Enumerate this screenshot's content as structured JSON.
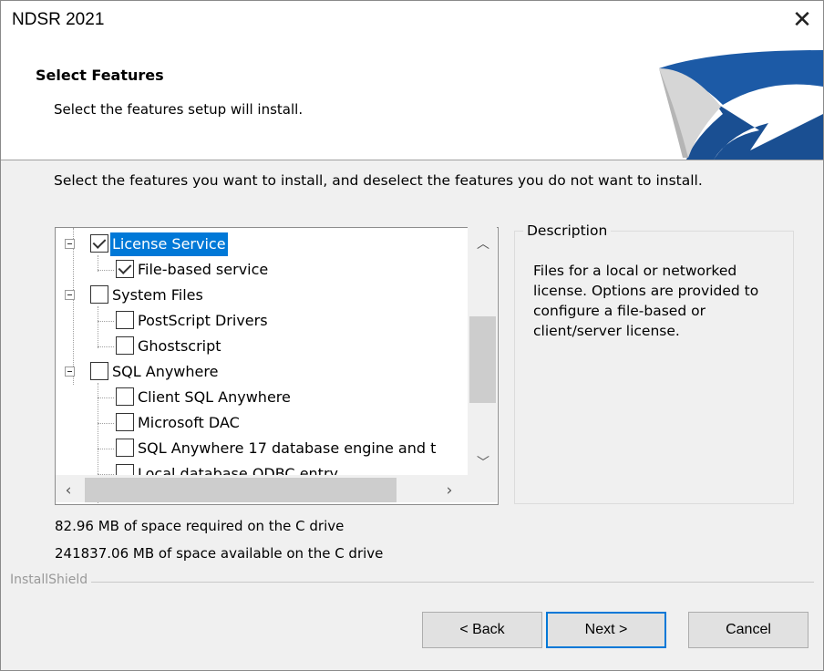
{
  "window": {
    "title": "NDSR 2021",
    "close_glyph": "✕"
  },
  "header": {
    "title": "Select Features",
    "subtitle": "Select the features setup will install."
  },
  "instructions": "Select the features you want to install, and deselect the features you do not want to install.",
  "tree": {
    "items": [
      {
        "label": "License Service",
        "checked": true,
        "selected": true
      },
      {
        "label": "File-based service",
        "checked": true
      },
      {
        "label": "System Files",
        "checked": false
      },
      {
        "label": "PostScript Drivers",
        "checked": false
      },
      {
        "label": "Ghostscript",
        "checked": false
      },
      {
        "label": "SQL Anywhere",
        "checked": false
      },
      {
        "label": "Client SQL Anywhere",
        "checked": false
      },
      {
        "label": "Microsoft DAC",
        "checked": false
      },
      {
        "label": "SQL Anywhere 17 database engine and t",
        "checked": false
      },
      {
        "label": "Local database ODBC entry",
        "checked": false
      }
    ]
  },
  "description": {
    "title": "Description",
    "text": "Files for a local or networked license. Options are provided to configure a file-based or client/server license."
  },
  "space": {
    "required": "82.96 MB of space required on the C drive",
    "available": "241837.06 MB of space available on the C drive"
  },
  "installshield_label": "InstallShield",
  "buttons": {
    "back": "< Back",
    "next": "Next >",
    "cancel": "Cancel"
  },
  "colors": {
    "selection": "#0078d7",
    "logo_blue": "#1c5aa6"
  }
}
